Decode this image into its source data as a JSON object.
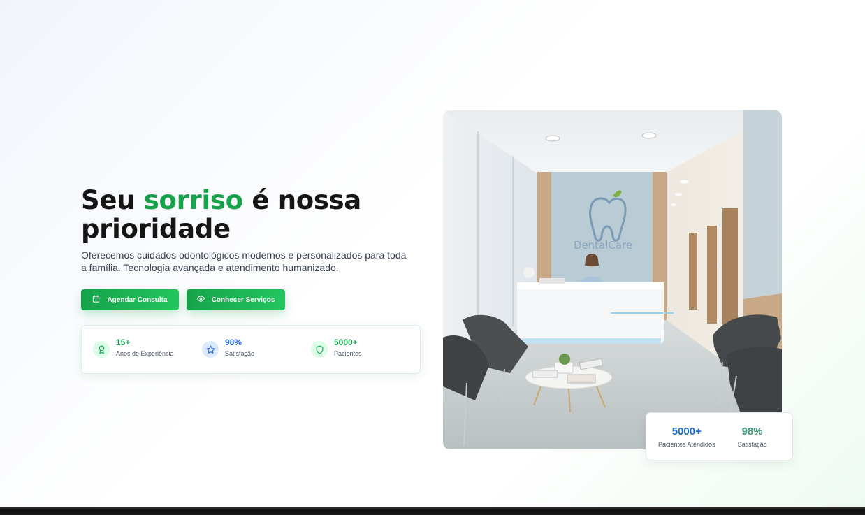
{
  "hero": {
    "title_part1": "Seu ",
    "title_accent": "sorriso",
    "title_part2": " é nossa prioridade",
    "subtitle": "Oferecemos cuidados odontológicos modernos e personalizados para toda a família. Tecnologia avançada e atendimento humanizado.",
    "primary_button": "Agendar Consulta",
    "secondary_button": "Conhecer Serviços"
  },
  "stats": [
    {
      "value": "15+",
      "label": "Anos de Experiência",
      "icon": "award-icon",
      "color": "#16a34a"
    },
    {
      "value": "98%",
      "label": "Satisfação",
      "icon": "star-icon",
      "color": "#2563eb"
    },
    {
      "value": "5000+",
      "label": "Pacientes",
      "icon": "shield-icon",
      "color": "#16a34a"
    }
  ],
  "image": {
    "sign_text": "DentalCare"
  },
  "floating_card": {
    "patients_value": "5000+",
    "patients_label": "Pacientes Atendidos",
    "satisfaction_value": "98%",
    "satisfaction_label": "Satisfação"
  },
  "colors": {
    "brand_green": "#16a34a",
    "accent_blue": "#2563eb"
  }
}
